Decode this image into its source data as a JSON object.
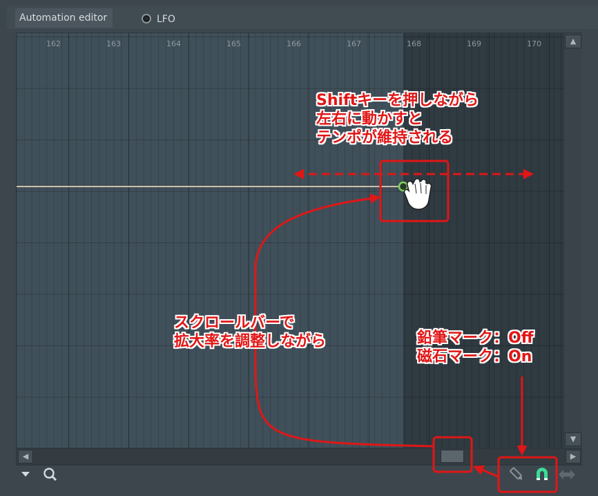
{
  "tabs": {
    "editor_label": "Automation editor",
    "lfo_label": "LFO"
  },
  "ruler": {
    "bars": [
      "162",
      "163",
      "164",
      "165",
      "166",
      "167",
      "168",
      "169",
      "170"
    ]
  },
  "annotations": {
    "shift_note": "Shiftキーを押しながら\n左右に動かすと\nテンポが維持される",
    "scroll_note": "スクロールバーで\n拡大率を調整しながら",
    "tool_note": "鉛筆マーク：Off\n磁石マーク：On"
  },
  "tools": {
    "pencil": "off",
    "magnet": "on"
  },
  "colors": {
    "annotation": "#e11616",
    "automation_line": "#cdbfa8",
    "point": "#7fd35a",
    "magnet": "#3ddc97"
  },
  "icons": [
    "dropdown-arrow-icon",
    "zoom-icon",
    "pencil-icon",
    "magnet-icon",
    "arrows-icon",
    "scroll-up-icon",
    "scroll-down-icon",
    "scroll-left-icon",
    "scroll-right-icon",
    "hand-cursor-icon"
  ]
}
